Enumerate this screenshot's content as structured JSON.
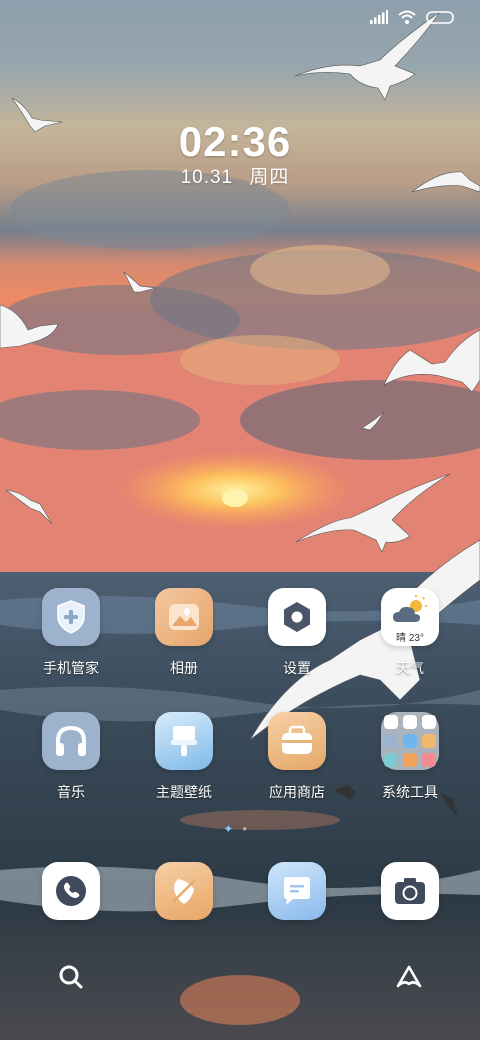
{
  "clock": {
    "time": "02:36",
    "date": "10.31",
    "weekday": "周四"
  },
  "apps": [
    {
      "id": "phone-manager",
      "label": "手机管家",
      "icon": "shield-plus-icon"
    },
    {
      "id": "gallery",
      "label": "相册",
      "icon": "gallery-icon"
    },
    {
      "id": "settings",
      "label": "设置",
      "icon": "gear-icon"
    },
    {
      "id": "weather",
      "label": "天气",
      "icon": "weather-icon",
      "badge": "晴 23°"
    },
    {
      "id": "music",
      "label": "音乐",
      "icon": "headphones-icon"
    },
    {
      "id": "themes",
      "label": "主题壁纸",
      "icon": "brush-icon"
    },
    {
      "id": "app-store",
      "label": "应用商店",
      "icon": "store-icon"
    },
    {
      "id": "system-tools",
      "label": "系统工具",
      "icon": "folder-icon"
    }
  ],
  "dock": [
    {
      "id": "phone",
      "icon": "phone-icon"
    },
    {
      "id": "browser",
      "icon": "compass-icon"
    },
    {
      "id": "messages",
      "icon": "message-icon"
    },
    {
      "id": "camera",
      "icon": "camera-icon"
    }
  ],
  "colors": {
    "sky_top": "#8ea0ad",
    "sunset": "#e88a5a",
    "sea": "#2e3e4c"
  }
}
